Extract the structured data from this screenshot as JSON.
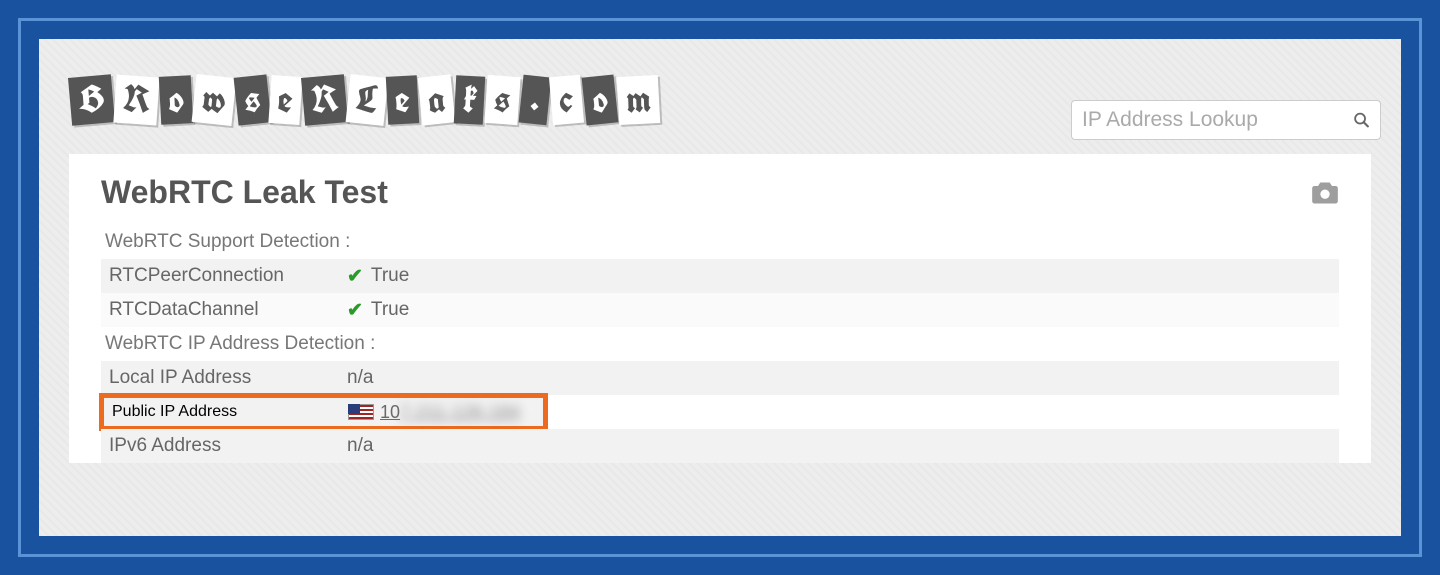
{
  "logo": {
    "tiles": [
      "B",
      "R",
      "o",
      "w",
      "s",
      "e",
      "R",
      "L",
      "e",
      "a",
      "k",
      "s",
      ".",
      "c",
      "o",
      "m"
    ]
  },
  "search": {
    "placeholder": "IP Address Lookup"
  },
  "page": {
    "title": "WebRTC Leak Test"
  },
  "sections": {
    "support": {
      "label": "WebRTC Support Detection :",
      "rows": [
        {
          "label": "RTCPeerConnection",
          "value": "True",
          "ok": true
        },
        {
          "label": "RTCDataChannel",
          "value": "True",
          "ok": true
        }
      ]
    },
    "ip": {
      "label": "WebRTC IP Address Detection :",
      "rows": [
        {
          "label": "Local IP Address",
          "value": "n/a"
        },
        {
          "label": "Public IP Address",
          "value_visible": "10",
          "value_blurred": "7.211.126.184",
          "flag": "us",
          "highlighted": true
        },
        {
          "label": "IPv6 Address",
          "value": "n/a"
        }
      ]
    }
  }
}
